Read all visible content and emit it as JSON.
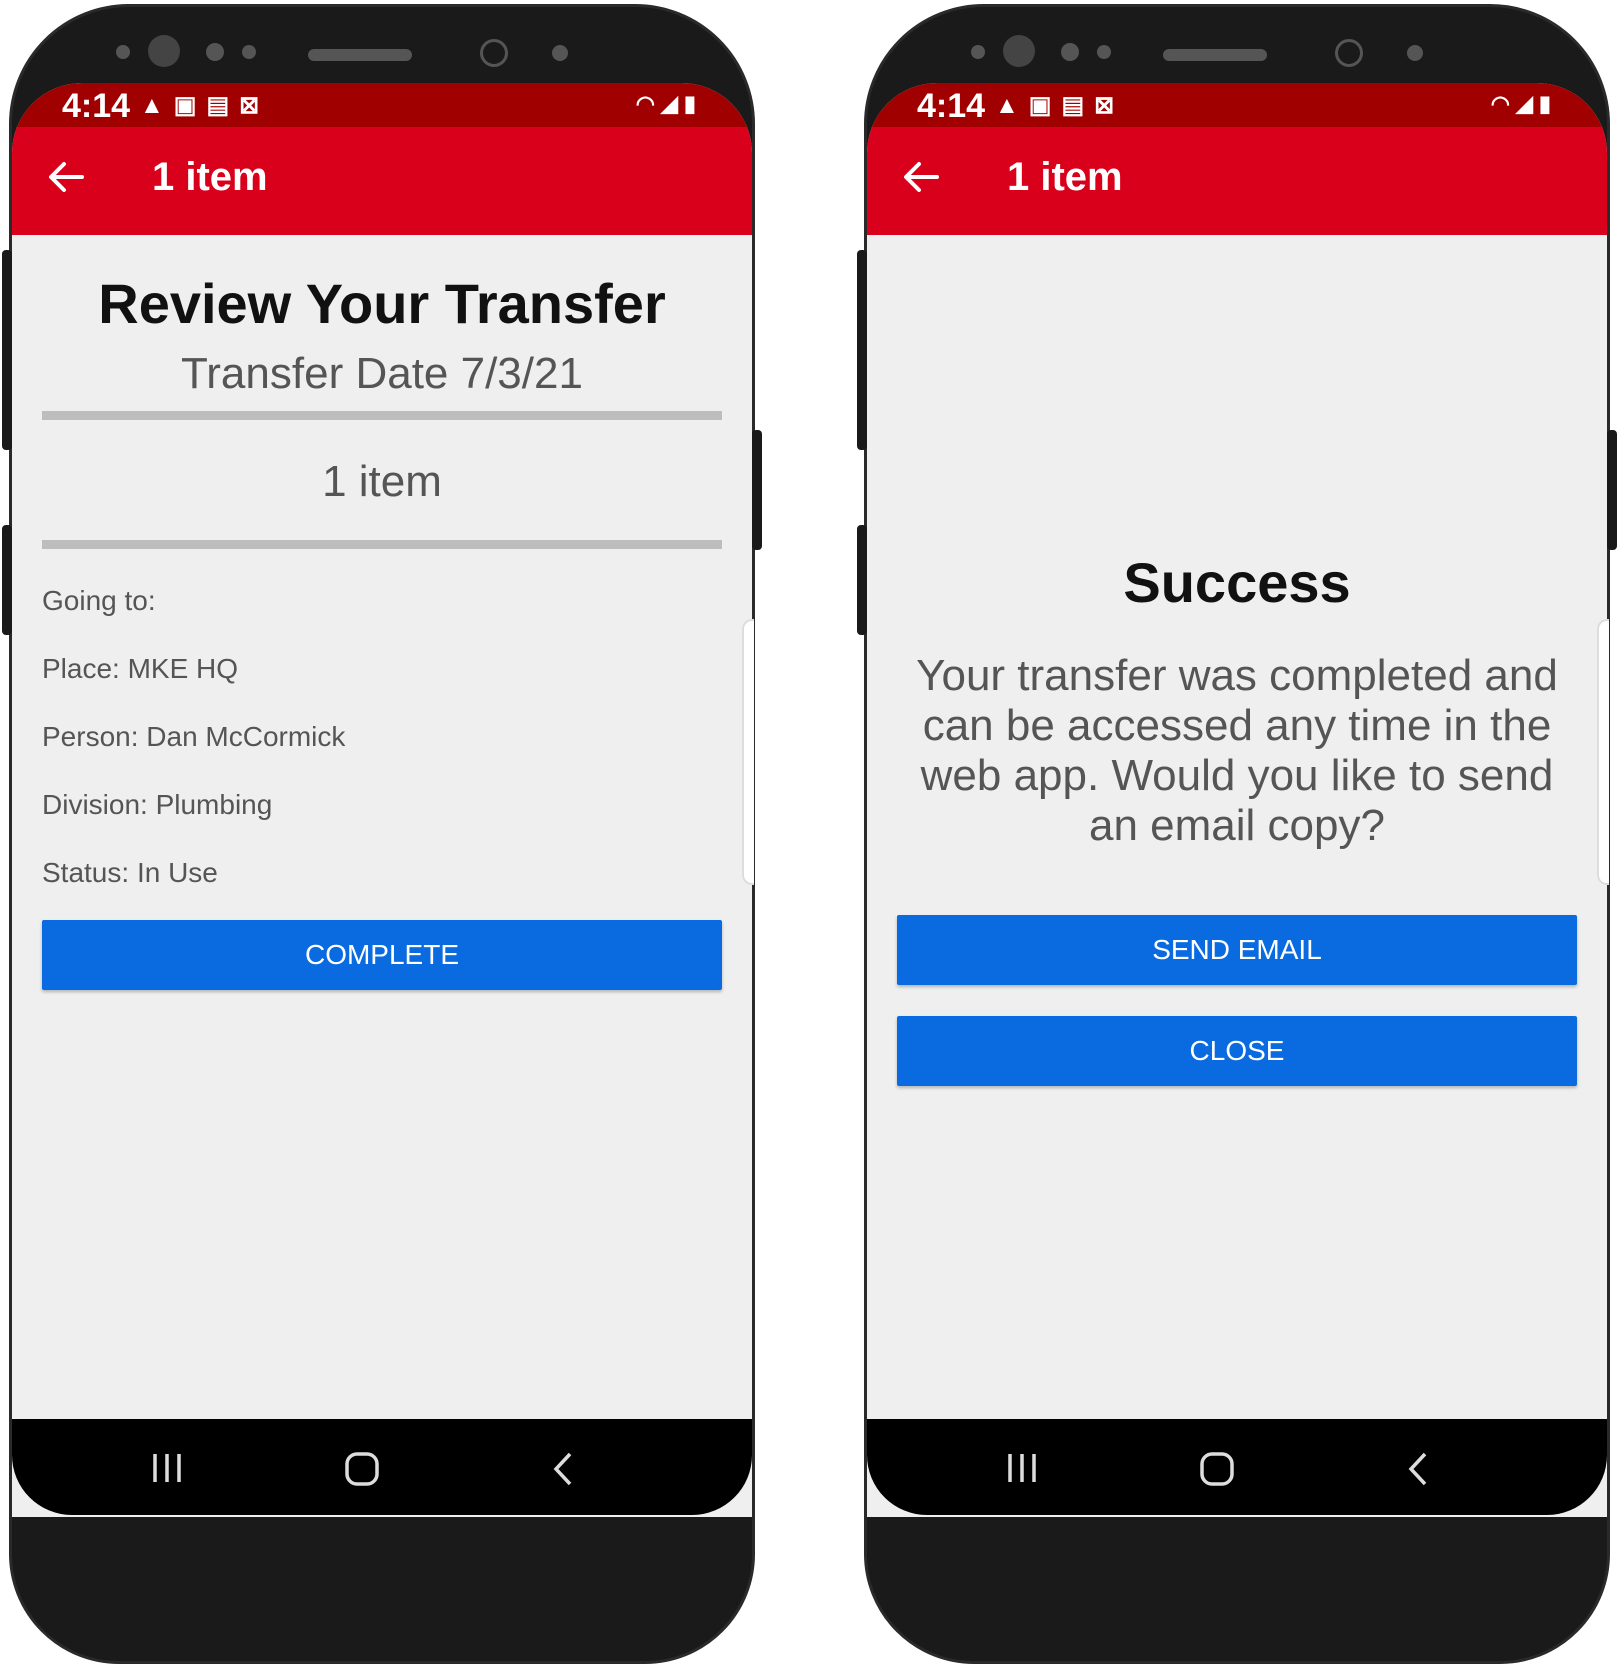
{
  "status_bar": {
    "time": "4:14",
    "left_icons": [
      "warning-icon",
      "outlook-icon",
      "image-icon",
      "close-box-icon"
    ],
    "right_icons": [
      "wifi-icon",
      "signal-icon",
      "battery-icon"
    ]
  },
  "left_screen": {
    "appbar_title": "1 item",
    "heading": "Review Your Transfer",
    "transfer_date": "Transfer Date 7/3/21",
    "items_count": "1 item",
    "details": {
      "going_to": "Going to:",
      "place": "Place: MKE HQ",
      "person": "Person: Dan McCormick",
      "division": "Division: Plumbing",
      "status": "Status: In Use"
    },
    "complete_label": "COMPLETE"
  },
  "right_screen": {
    "appbar_title": "1 item",
    "heading": "Success",
    "message": "Your transfer was completed and can be accessed any time in the web app. Would you like to send an email copy?",
    "send_email_label": "SEND EMAIL",
    "close_label": "CLOSE"
  },
  "colors": {
    "appbar": "#d9001b",
    "statusbar": "#a00000",
    "button": "#0a6be0",
    "background": "#efefef"
  }
}
